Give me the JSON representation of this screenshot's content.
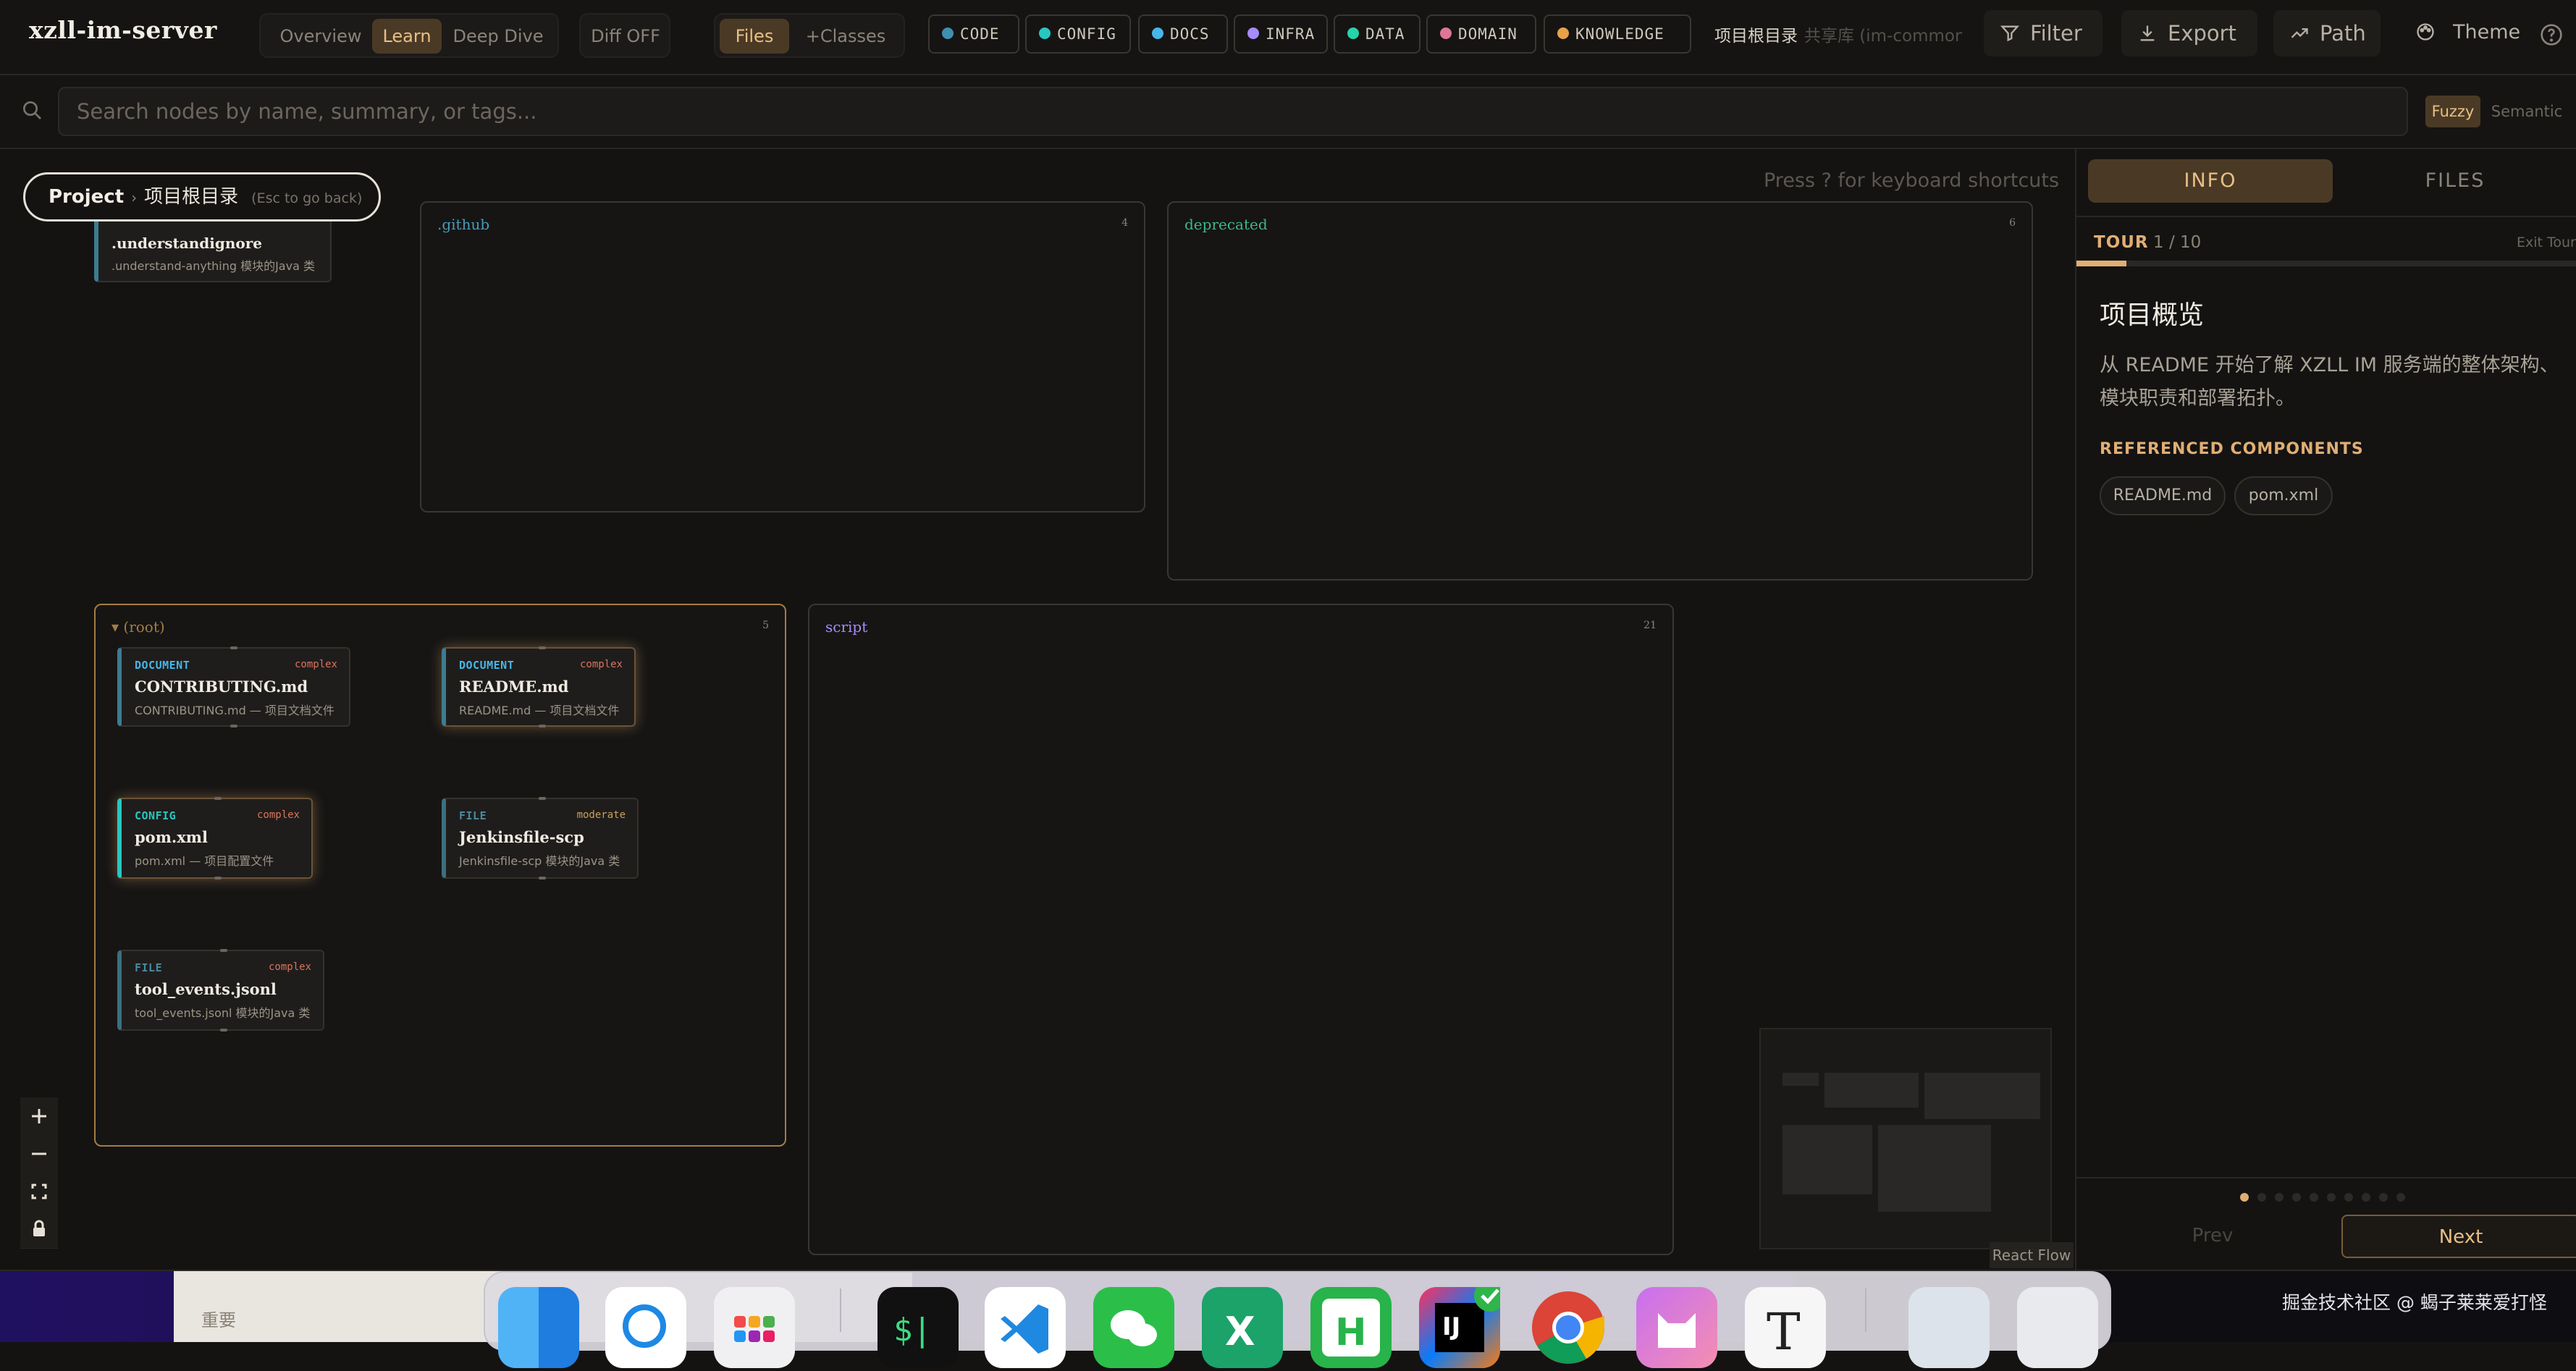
{
  "header": {
    "app_title": "xzll-im-server",
    "modes": [
      "Overview",
      "Learn",
      "Deep Dive"
    ],
    "active_mode": "Learn",
    "diff_label": "Diff OFF",
    "views": [
      "Files",
      "+Classes"
    ],
    "active_view": "Files",
    "categories": [
      {
        "label": "CODE",
        "color": "#3f8fb0"
      },
      {
        "label": "CONFIG",
        "color": "#27c7c0"
      },
      {
        "label": "DOCS",
        "color": "#47b6e8"
      },
      {
        "label": "INFRA",
        "color": "#a78bfa"
      },
      {
        "label": "DATA",
        "color": "#25d4a8"
      },
      {
        "label": "DOMAIN",
        "color": "#e0759a"
      },
      {
        "label": "KNOWLEDGE",
        "color": "#e8a24a"
      }
    ],
    "project_label": "项目根目录",
    "shared_label": "共享库 (im-common",
    "filter_label": "Filter",
    "export_label": "Export",
    "path_label": "Path",
    "theme_label": "Theme"
  },
  "search": {
    "placeholder": "Search nodes by name, summary, or tags...",
    "modes": [
      "Fuzzy",
      "Semantic"
    ],
    "active_mode": "Fuzzy"
  },
  "canvas": {
    "breadcrumb_root": "Project",
    "breadcrumb_current": "项目根目录",
    "breadcrumb_hint": "(Esc to go back)",
    "shortcuts_hint": "Press ? for keyboard shortcuts",
    "partial_node": {
      "name": ".understandignore",
      "desc": ".understand-anything 模块的Java 类"
    },
    "groups": [
      {
        "title": ".github",
        "count": "4",
        "color": "#4a9bb8"
      },
      {
        "title": "deprecated",
        "count": "6",
        "color": "#3fb68b"
      },
      {
        "title": "(root)",
        "count": "5",
        "color": "#a57c44"
      },
      {
        "title": "script",
        "count": "21",
        "color": "#a78bfa"
      }
    ],
    "nodes": [
      {
        "type": "DOCUMENT",
        "complexity": "complex",
        "name": "CONTRIBUTING.md",
        "desc": "CONTRIBUTING.md — 项目文档文件"
      },
      {
        "type": "DOCUMENT",
        "complexity": "complex",
        "name": "README.md",
        "desc": "README.md — 项目文档文件"
      },
      {
        "type": "CONFIG",
        "complexity": "complex",
        "name": "pom.xml",
        "desc": "pom.xml — 项目配置文件"
      },
      {
        "type": "FILE",
        "complexity": "moderate",
        "name": "Jenkinsfile-scp",
        "desc": "Jenkinsfile-scp 模块的Java 类"
      },
      {
        "type": "FILE",
        "complexity": "complex",
        "name": "tool_events.jsonl",
        "desc": "tool_events.jsonl 模块的Java 类"
      }
    ],
    "react_flow_label": "React Flow"
  },
  "panel": {
    "tabs": [
      "INFO",
      "FILES"
    ],
    "active_tab": "INFO",
    "tour_label": "TOUR",
    "tour_step": "1 / 10",
    "tour_progress": 0.1,
    "exit_label": "Exit Tour",
    "step_title": "项目概览",
    "step_body": "从 README 开始了解 XZLL IM 服务端的整体架构、模块职责和部署拓扑。",
    "referenced_label": "REFERENCED COMPONENTS",
    "components": [
      "README.md",
      "pom.xml"
    ],
    "prev_label": "Prev",
    "next_label": "Next",
    "total_steps": 10,
    "current_step": 1
  },
  "desktop": {
    "partial_window_text": "重要",
    "watermark": "掘金技术社区 @ 蝎子莱莱爱打怪"
  }
}
